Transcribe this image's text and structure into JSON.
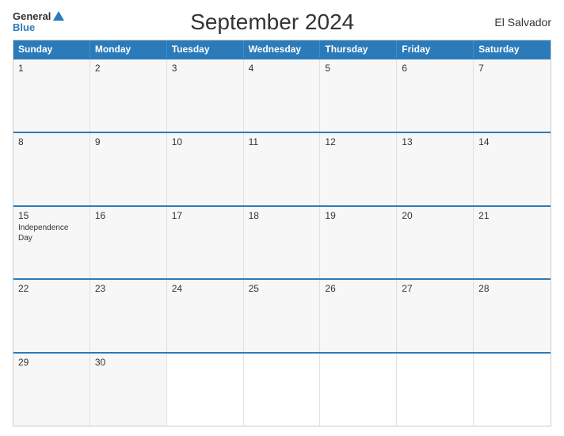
{
  "header": {
    "logo_general": "General",
    "logo_blue": "Blue",
    "title": "September 2024",
    "country": "El Salvador"
  },
  "weekdays": [
    "Sunday",
    "Monday",
    "Tuesday",
    "Wednesday",
    "Thursday",
    "Friday",
    "Saturday"
  ],
  "weeks": [
    [
      {
        "day": "1",
        "holiday": ""
      },
      {
        "day": "2",
        "holiday": ""
      },
      {
        "day": "3",
        "holiday": ""
      },
      {
        "day": "4",
        "holiday": ""
      },
      {
        "day": "5",
        "holiday": ""
      },
      {
        "day": "6",
        "holiday": ""
      },
      {
        "day": "7",
        "holiday": ""
      }
    ],
    [
      {
        "day": "8",
        "holiday": ""
      },
      {
        "day": "9",
        "holiday": ""
      },
      {
        "day": "10",
        "holiday": ""
      },
      {
        "day": "11",
        "holiday": ""
      },
      {
        "day": "12",
        "holiday": ""
      },
      {
        "day": "13",
        "holiday": ""
      },
      {
        "day": "14",
        "holiday": ""
      }
    ],
    [
      {
        "day": "15",
        "holiday": "Independence Day"
      },
      {
        "day": "16",
        "holiday": ""
      },
      {
        "day": "17",
        "holiday": ""
      },
      {
        "day": "18",
        "holiday": ""
      },
      {
        "day": "19",
        "holiday": ""
      },
      {
        "day": "20",
        "holiday": ""
      },
      {
        "day": "21",
        "holiday": ""
      }
    ],
    [
      {
        "day": "22",
        "holiday": ""
      },
      {
        "day": "23",
        "holiday": ""
      },
      {
        "day": "24",
        "holiday": ""
      },
      {
        "day": "25",
        "holiday": ""
      },
      {
        "day": "26",
        "holiday": ""
      },
      {
        "day": "27",
        "holiday": ""
      },
      {
        "day": "28",
        "holiday": ""
      }
    ],
    [
      {
        "day": "29",
        "holiday": ""
      },
      {
        "day": "30",
        "holiday": ""
      },
      {
        "day": "",
        "holiday": ""
      },
      {
        "day": "",
        "holiday": ""
      },
      {
        "day": "",
        "holiday": ""
      },
      {
        "day": "",
        "holiday": ""
      },
      {
        "day": "",
        "holiday": ""
      }
    ]
  ]
}
